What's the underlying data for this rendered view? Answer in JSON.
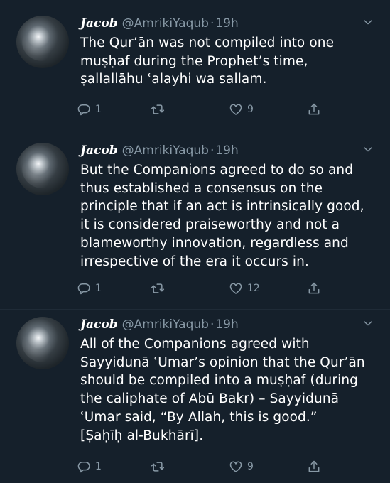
{
  "tweets": [
    {
      "name": "Jacob",
      "handle": "@AmrikiYaqub",
      "separator": "·",
      "time": "19h",
      "text": "The Qur’ān was not compiled into one\nmuṣḥaf during the Prophet’s time,\nṣallallāhu ʿalayhi wa sallam.",
      "replies": "1",
      "retweets": "",
      "likes": "9"
    },
    {
      "name": "Jacob",
      "handle": "@AmrikiYaqub",
      "separator": "·",
      "time": "19h",
      "text": "But the Companions agreed to do so and\nthus established a consensus on the\nprinciple that if an act is intrinsically good,\nit is considered praiseworthy and not a\nblameworthy innovation, regardless and\nirrespective of the era it occurs in.",
      "replies": "1",
      "retweets": "",
      "likes": "12"
    },
    {
      "name": "Jacob",
      "handle": "@AmrikiYaqub",
      "separator": "·",
      "time": "19h",
      "text": "All of the Companions agreed with\nSayyidunā ʿUmar’s opinion that the Qur’ān\nshould be compiled into a muṣḥaf (during\nthe caliphate of Abū Bakr) – Sayyidunā\nʿUmar said, “By Allah, this is good.”\n[Ṣaḥīḥ al-Bukhārī].",
      "replies": "1",
      "retweets": "",
      "likes": "9"
    }
  ],
  "icons": {
    "reply": "reply-icon",
    "retweet": "retweet-icon",
    "like": "heart-icon",
    "share": "share-icon",
    "menu": "chevron-down-icon"
  },
  "colors": {
    "background": "#15202b",
    "text": "#ffffff",
    "secondary": "#8899a6"
  }
}
